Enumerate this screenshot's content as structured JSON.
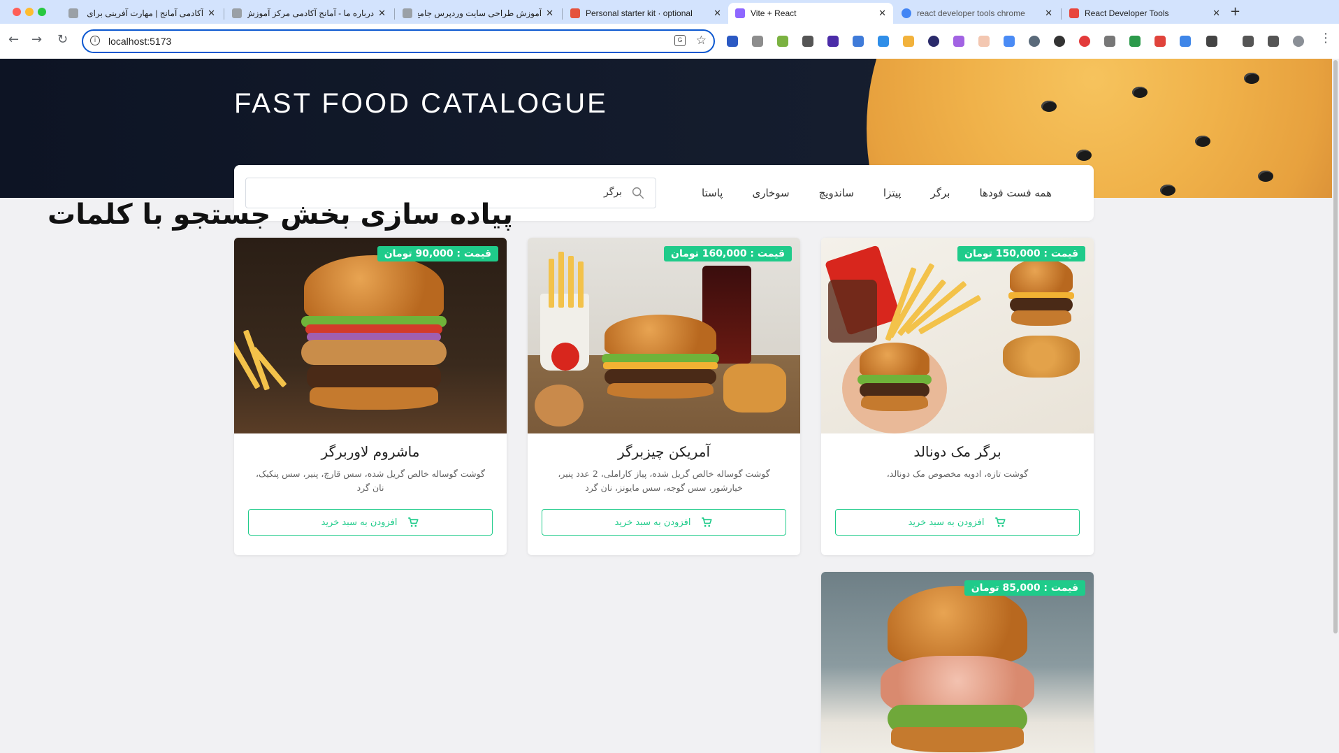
{
  "browser": {
    "tabs": [
      {
        "title": "آکادمی آمانج | مهارت آفرینی برای و",
        "fav_color": "#9aa0a6"
      },
      {
        "title": "درباره ما - آمانج آکادمی مرکز آموزش",
        "fav_color": "#9aa0a6"
      },
      {
        "title": "آموزش طراحی سایت وردپرس جامع",
        "fav_color": "#9aa0a6"
      },
      {
        "title": "Personal starter kit · optional",
        "fav_color": "#e5533d"
      },
      {
        "title": "Vite + React",
        "fav_color": "#8e67ff"
      },
      {
        "title": "react developer tools chrome",
        "fav_color": "#4285f4"
      },
      {
        "title": "React Developer Tools",
        "fav_color": "#e8453c"
      }
    ],
    "url": "localhost:5173"
  },
  "hero": {
    "title": "FAST FOOD CATALOGUE"
  },
  "categories": [
    "همه فست فودها",
    "برگر",
    "پیتزا",
    "ساندویچ",
    "سوخاری",
    "پاستا"
  ],
  "search": {
    "value": "برگر"
  },
  "overlay_caption": "پیاده سازی بخش جستجو با کلمات",
  "products": [
    {
      "price": "قیمت : 150,000 تومان",
      "name": "برگر مک دونالد",
      "description": "گوشت تازه، ادویه مخصوص مک دونالد،",
      "button": "افزودن به سبد خرید"
    },
    {
      "price": "قیمت : 160,000 تومان",
      "name": "آمریکن چیزبرگر",
      "description": "گوشت گوساله خالص گریل شده، پیاز کاراملی، 2 عدد پنیر، خیارشور، سس گوجه، سس مایونز، نان گرد",
      "button": "افزودن به سبد خرید"
    },
    {
      "price": "قیمت : 90,000 تومان",
      "name": "ماشروم لاوربرگر",
      "description": "گوشت گوساله خالص گریل شده، سس قارچ، پنیر، سس پنکیک، نان گرد",
      "button": "افزودن به سبد خرید"
    },
    {
      "price": "قیمت : 85,000 تومان"
    }
  ],
  "colors": {
    "accent": "#1fcb8a",
    "hero_bg": "#0d1424"
  }
}
